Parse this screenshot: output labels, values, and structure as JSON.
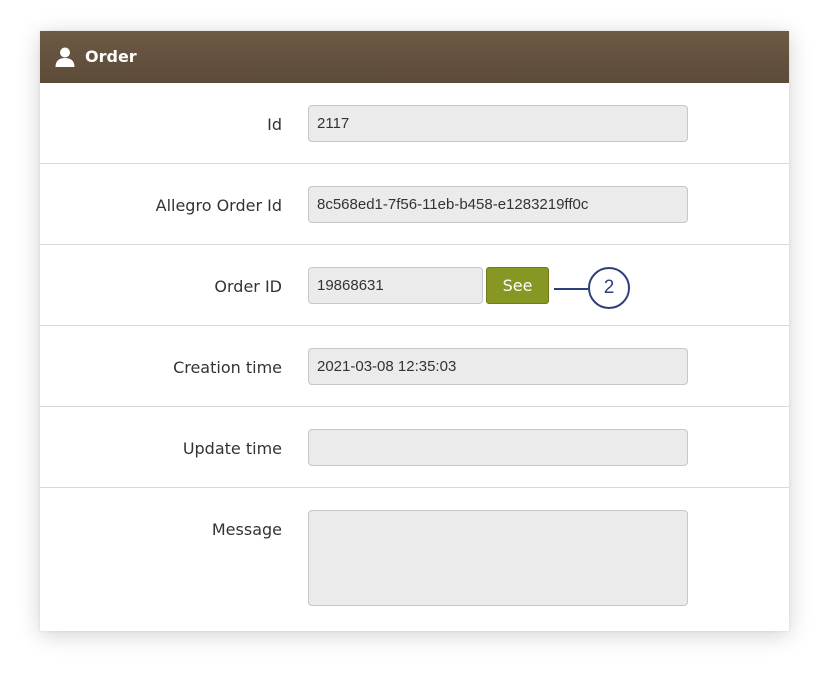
{
  "header": {
    "icon": "user-icon",
    "title": "Order"
  },
  "fields": {
    "id": {
      "label": "Id",
      "value": "2117"
    },
    "allegro_order_id": {
      "label": "Allegro Order Id",
      "value": "8c568ed1-7f56-11eb-b458-e1283219ff0c"
    },
    "order_id": {
      "label": "Order ID",
      "value": "19868631",
      "button_label": "See"
    },
    "creation_time": {
      "label": "Creation time",
      "value": "2021-03-08 12:35:03"
    },
    "update_time": {
      "label": "Update time",
      "value": ""
    },
    "message": {
      "label": "Message",
      "value": ""
    }
  },
  "callout": {
    "number": "2"
  },
  "colors": {
    "header_bg": "#5f4e3b",
    "button_bg": "#889623",
    "callout": "#2f3f7a"
  }
}
